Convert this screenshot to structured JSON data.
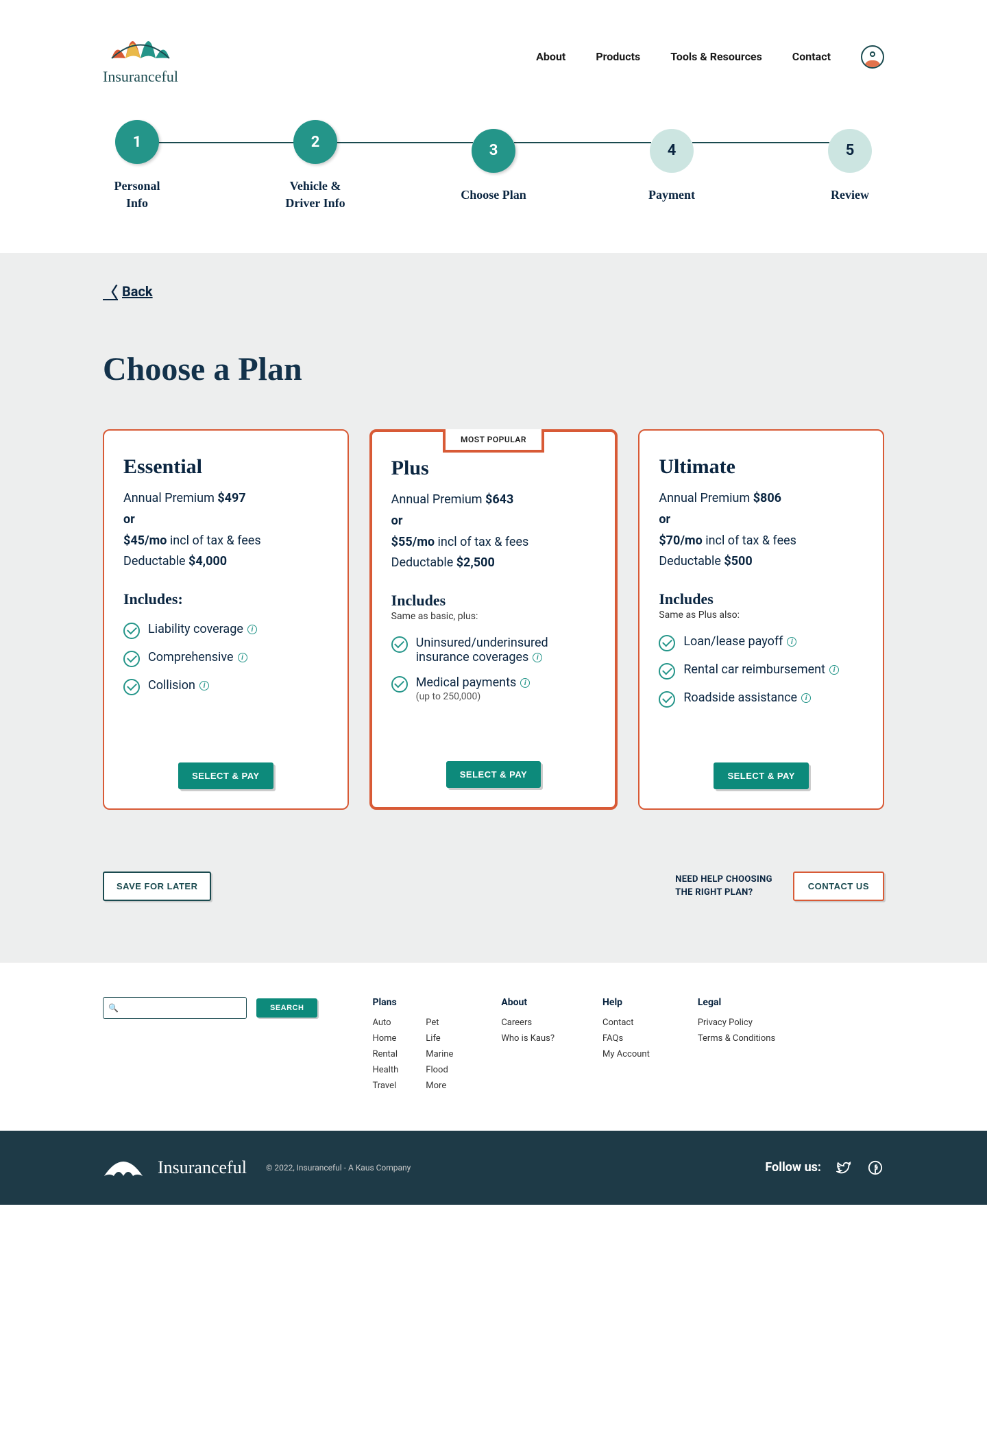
{
  "brand": {
    "name": "Insuranceful"
  },
  "nav": {
    "about": "About",
    "products": "Products",
    "tools": "Tools & Resources",
    "contact": "Contact"
  },
  "stepper": {
    "steps": [
      {
        "num": "1",
        "label": "Personal Info"
      },
      {
        "num": "2",
        "label": "Vehicle & Driver Info"
      },
      {
        "num": "3",
        "label": "Choose Plan"
      },
      {
        "num": "4",
        "label": "Payment"
      },
      {
        "num": "5",
        "label": "Review"
      }
    ]
  },
  "back_label": "Back",
  "page_title": "Choose a Plan",
  "plans": {
    "badge": "MOST POPULAR",
    "select_label": "SELECT & PAY",
    "essential": {
      "name": "Essential",
      "premium_label": "Annual Premium ",
      "premium_value": "$497",
      "or": "or",
      "monthly_bold": "$45/mo",
      "monthly_rest": " incl of tax & fees",
      "deductible_label": "Deductable ",
      "deductible_value": "$4,000",
      "includes": "Includes:",
      "sub": "",
      "f1": "Liability coverage",
      "f2": "Comprehensive",
      "f3": "Collision"
    },
    "plus": {
      "name": "Plus",
      "premium_label": "Annual Premium ",
      "premium_value": "$643",
      "or": "or",
      "monthly_bold": "$55/mo",
      "monthly_rest": " incl of tax & fees",
      "deductible_label": "Deductable ",
      "deductible_value": "$2,500",
      "includes": "Includes",
      "sub": "Same as basic, plus:",
      "f1": "Uninsured/underinsured insurance coverages",
      "f2": "Medical payments",
      "f2_small": "(up to 250,000)"
    },
    "ultimate": {
      "name": "Ultimate",
      "premium_label": "Annual Premium ",
      "premium_value": "$806",
      "or": "or",
      "monthly_bold": "$70/mo",
      "monthly_rest": " incl of tax & fees",
      "deductible_label": "Deductable ",
      "deductible_value": "$500",
      "includes": "Includes",
      "sub": "Same as Plus also:",
      "f1": "Loan/lease payoff",
      "f2": "Rental car reimbursement",
      "f3": "Roadside assistance"
    }
  },
  "bottom": {
    "save": "SAVE FOR LATER",
    "help_line1": "NEED HELP CHOOSING",
    "help_line2": "THE RIGHT PLAN?",
    "contact": "CONTACT US"
  },
  "footer": {
    "search_btn": "SEARCH",
    "cols": {
      "plans": {
        "title": "Plans",
        "a1": "Auto",
        "a2": "Home",
        "a3": "Rental",
        "a4": "Health",
        "a5": "Travel",
        "b1": "Pet",
        "b2": "Life",
        "b3": "Marine",
        "b4": "Flood",
        "b5": "More"
      },
      "about": {
        "title": "About",
        "l1": "Careers",
        "l2": "Who is Kaus?"
      },
      "help": {
        "title": "Help",
        "l1": "Contact",
        "l2": "FAQs",
        "l3": "My Account"
      },
      "legal": {
        "title": "Legal",
        "l1": "Privacy Policy",
        "l2": "Terms & Conditions"
      }
    }
  },
  "bar": {
    "name": "Insuranceful",
    "copy": "© 2022, Insuranceful - A Kaus Company",
    "follow": "Follow us:"
  }
}
